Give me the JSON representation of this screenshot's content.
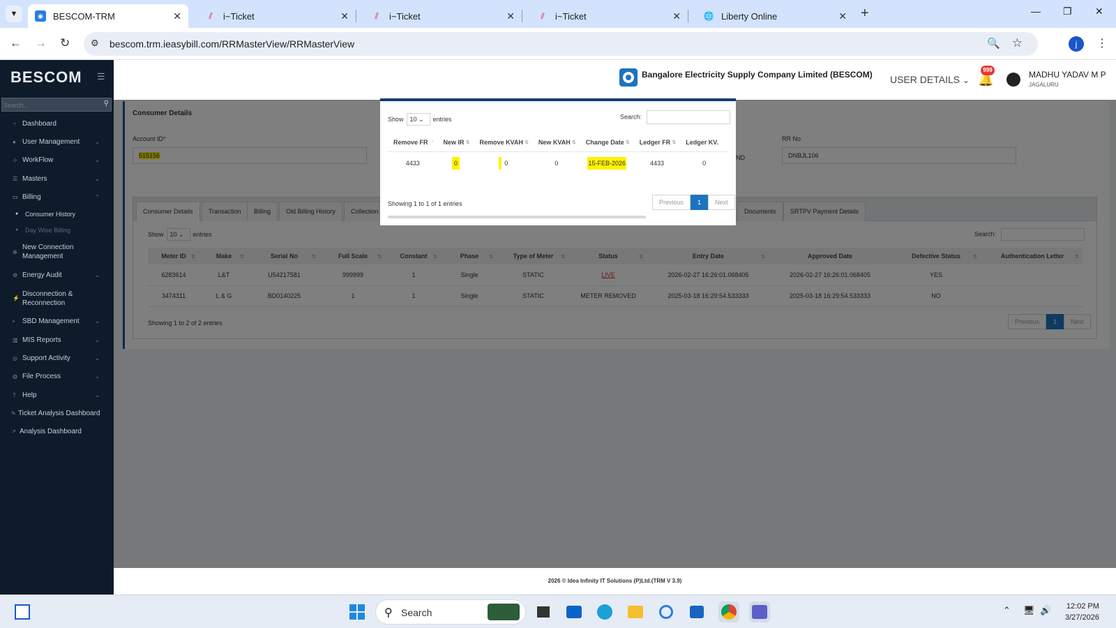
{
  "browser": {
    "tabs": [
      {
        "title": "BESCOM-TRM",
        "active": true
      },
      {
        "title": "i~Ticket",
        "active": false
      },
      {
        "title": "i~Ticket",
        "active": false
      },
      {
        "title": "i~Ticket",
        "active": false
      },
      {
        "title": "Liberty Online",
        "active": false
      }
    ],
    "url": "bescom.trm.ieasybill.com/RRMasterView/RRMasterView",
    "profile_initial": "j"
  },
  "sidebar": {
    "brand": "BESCOM",
    "search_placeholder": "Search..",
    "items": [
      {
        "label": "Dashboard",
        "icon": "dashboard-icon"
      },
      {
        "label": "User Management",
        "icon": "user-icon"
      },
      {
        "label": "WorkFlow",
        "icon": "workflow-icon"
      },
      {
        "label": "Masters",
        "icon": "list-icon"
      },
      {
        "label": "Billing",
        "icon": "monitor-icon"
      },
      {
        "label": "New Connection Management",
        "icon": "plus-circle-icon"
      },
      {
        "label": "Energy Audit",
        "icon": "audit-icon"
      },
      {
        "label": "Disconnection & Reconnection",
        "icon": "plug-icon"
      },
      {
        "label": "SBD Management",
        "icon": "sbd-icon"
      },
      {
        "label": "MIS Reports",
        "icon": "chart-icon"
      },
      {
        "label": "Support Activity",
        "icon": "support-icon"
      },
      {
        "label": "File Process",
        "icon": "file-icon"
      },
      {
        "label": "Help",
        "icon": "help-icon"
      },
      {
        "label": "Ticket Analysis Dashboard",
        "icon": "ticket-icon"
      },
      {
        "label": "Analysis Dashboard",
        "icon": "analysis-icon"
      }
    ],
    "billing_sub": [
      "Consumer History",
      "Day Wise Billing"
    ]
  },
  "header": {
    "company": "Bangalore Electricity Supply Company Limited (BESCOM)",
    "user_details": "USER DETAILS",
    "notif_count": "999",
    "user_name": "MADHU YADAV M P",
    "user_location": "JAGALURU"
  },
  "consumer": {
    "section_title": "Consumer Details",
    "account_label": "Account ID",
    "account_value": "515156",
    "rr_label": "RR No",
    "rr_value": "DNBJL106",
    "partial_text": "ND"
  },
  "page_tabs": [
    "Consumer Details",
    "Transaction",
    "Billing",
    "Old Billing History",
    "Collection",
    "Documents",
    "SRTPV Payment Details"
  ],
  "meter_table": {
    "show": "Show",
    "entries_val": "10",
    "entries": "entries",
    "search": "Search:",
    "columns": [
      "Meter ID",
      "Make",
      "Serial No",
      "Full Scale",
      "Constant",
      "Phase",
      "Type of Meter",
      "Status",
      "Entry Date",
      "Approved Date",
      "Defective Status",
      "Authentication Letter"
    ],
    "rows": [
      [
        "6283614",
        "L&T",
        "U54217581",
        "999999",
        "1",
        "Single",
        "STATIC",
        "LIVE",
        "2026-02-27 16:26:01.068405",
        "2026-02-27 16:26:01.068405",
        "YES",
        ""
      ],
      [
        "3474311",
        "L & G",
        "BD0140225",
        "1",
        "1",
        "Single",
        "STATIC",
        "METER REMOVED",
        "2025-03-18 16:29:54.533333",
        "2025-03-18 16:29:54.533333",
        "NO",
        ""
      ]
    ],
    "info": "Showing 1 to 2 of 2 entries",
    "prev": "Previous",
    "page": "1",
    "next": "Next"
  },
  "modal": {
    "show": "Show",
    "entries_val": "10",
    "entries": "entries",
    "search": "Search:",
    "columns": [
      "Remove FR",
      "New IR",
      "Remove KVAH",
      "New KVAH",
      "Change Date",
      "Ledger FR",
      "Ledger KV."
    ],
    "row": [
      "4433",
      "0",
      "0",
      "0",
      "15-FEB-2026",
      "4433",
      "0"
    ],
    "info": "Showing 1 to 1 of 1 entries",
    "prev": "Previous",
    "page": "1",
    "next": "Next"
  },
  "footer": "2026 © Idea Infinity IT Solutions (P)Ltd.(TRM V 3.9)",
  "taskbar": {
    "search": "Search",
    "time": "12:02 PM",
    "date": "3/27/2026"
  },
  "colors": {
    "highlight": "#fff200",
    "sidebar": "#0d1b2a",
    "accent": "#1e73be",
    "live": "#d32f2f"
  }
}
